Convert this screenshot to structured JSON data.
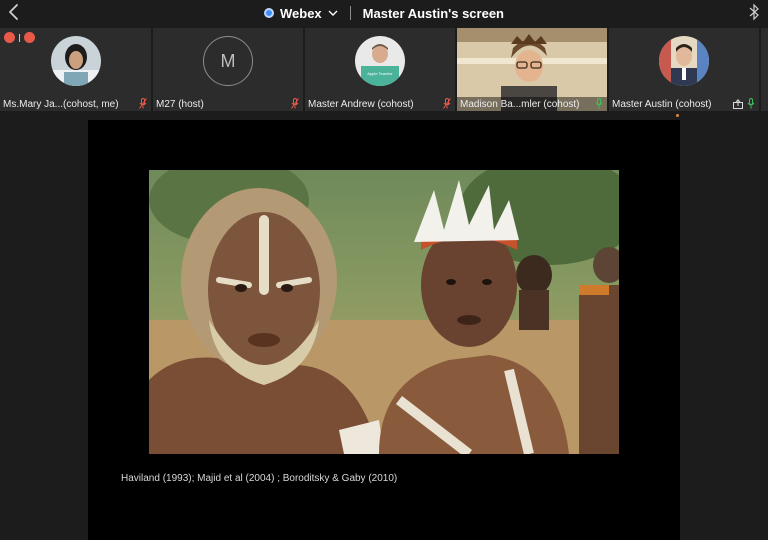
{
  "header": {
    "app_name": "Webex",
    "screen_title": "Master Austin's screen",
    "icons": {
      "back": "chevron-left-icon",
      "logo": "webex-logo-icon",
      "dropdown": "chevron-down-icon",
      "bluetooth": "bluetooth-icon"
    }
  },
  "participants": [
    {
      "name": "Ms.Mary Ja...(cohost, me)",
      "mic": "muted",
      "avatar": "photo"
    },
    {
      "name": "M27 (host)",
      "mic": "muted",
      "avatar": "letter",
      "initial": "M"
    },
    {
      "name": "Master Andrew (cohost)",
      "mic": "muted",
      "avatar": "photo",
      "shirt_text": "Apple Teacher"
    },
    {
      "name": "Madison Ba...mler (cohost)",
      "mic": "active",
      "avatar": "video"
    },
    {
      "name": "Master Austin (cohost)",
      "mic": "active",
      "avatar": "photo",
      "sharing": true
    }
  ],
  "colors": {
    "muted_mic": "#e8594a",
    "active_mic": "#3fbf5a",
    "accent": "#3f8ef7",
    "active_speaker": "#e08a3a"
  },
  "shared_content": {
    "caption": "Haviland (1993); Majid et al (2004) ; Boroditsky & Gaby (2010)"
  }
}
